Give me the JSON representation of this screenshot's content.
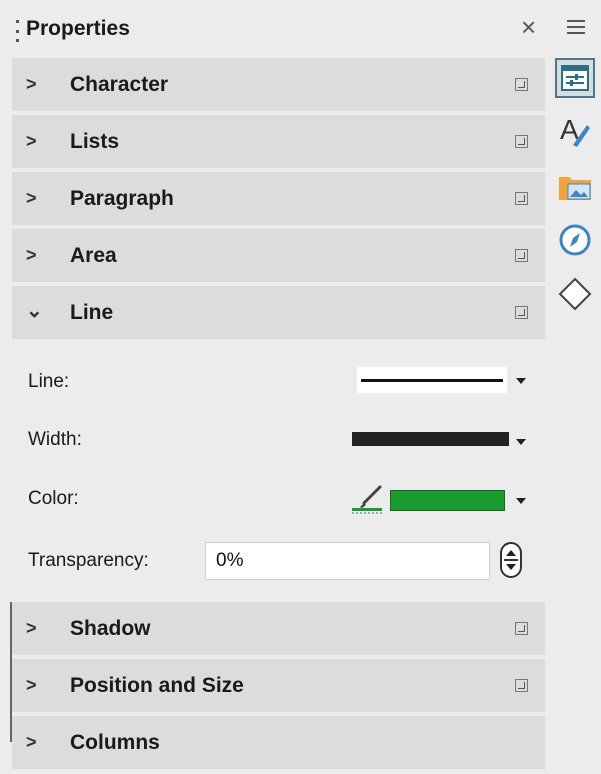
{
  "panel": {
    "title": "Properties",
    "close_glyph": "×"
  },
  "sections": [
    {
      "label": "Character",
      "expanded": false
    },
    {
      "label": "Lists",
      "expanded": false
    },
    {
      "label": "Paragraph",
      "expanded": false
    },
    {
      "label": "Area",
      "expanded": false
    },
    {
      "label": "Line",
      "expanded": true
    },
    {
      "label": "Shadow",
      "expanded": false
    },
    {
      "label": "Position and Size",
      "expanded": false
    },
    {
      "label": "Columns",
      "expanded": false
    }
  ],
  "line_section": {
    "line_label": "Line:",
    "width_label": "Width:",
    "color_label": "Color:",
    "transparency_label": "Transparency:",
    "transparency_value": "0%",
    "line_color": "#1a9b2f"
  },
  "tabs": [
    {
      "icon": "properties-icon",
      "active": true
    },
    {
      "icon": "styles-icon",
      "active": false
    },
    {
      "icon": "gallery-icon",
      "active": false
    },
    {
      "icon": "navigator-icon",
      "active": false
    },
    {
      "icon": "shapes-icon",
      "active": false
    }
  ],
  "glyphs": {
    "collapsed": ">",
    "expanded": "⌄"
  }
}
